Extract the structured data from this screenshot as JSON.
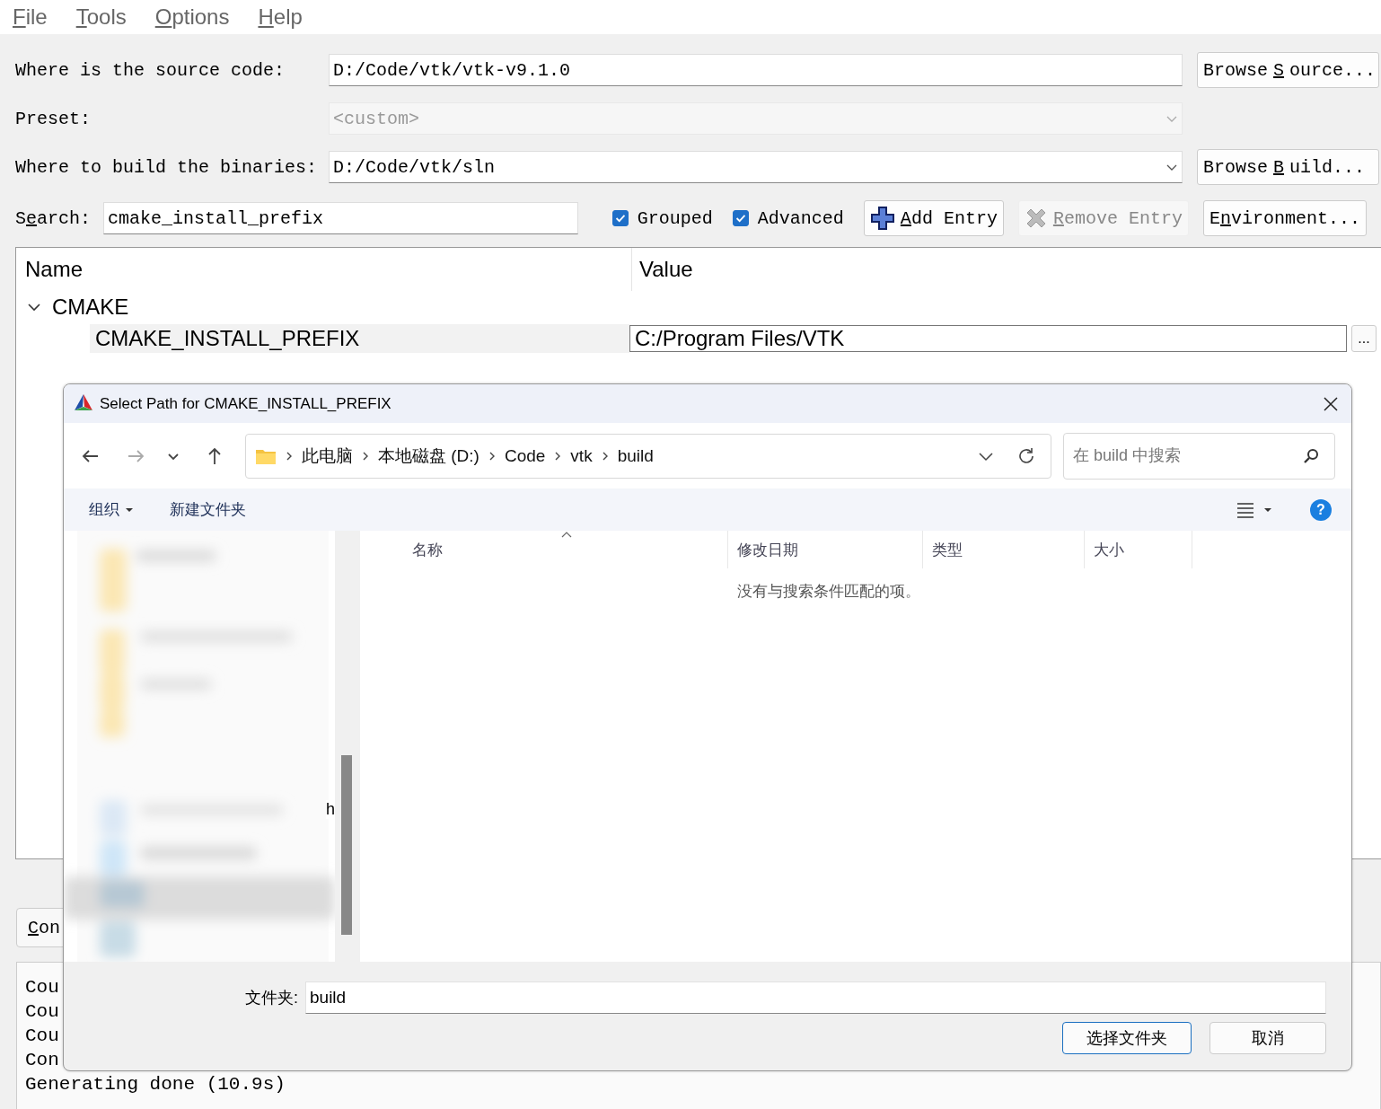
{
  "menu": [
    {
      "label_parts": [
        "F",
        "ile"
      ]
    },
    {
      "label_parts": [
        "T",
        "ools"
      ]
    },
    {
      "label_parts": [
        "O",
        "ptions"
      ]
    },
    {
      "label_parts": [
        "H",
        "elp"
      ]
    }
  ],
  "source": {
    "label": "Where is the source code:",
    "value": "D:/Code/vtk/vtk-v9.1.0",
    "button_parts": [
      "Browse ",
      "S",
      "ource..."
    ]
  },
  "preset": {
    "label": "Preset:",
    "value": "<custom>",
    "disabled": true
  },
  "build": {
    "label": "Where to build the binaries:",
    "value": "D:/Code/vtk/sln",
    "button_parts": [
      "Browse ",
      "B",
      "uild..."
    ]
  },
  "search": {
    "label_parts": [
      "S",
      "e",
      "arch:"
    ],
    "value": "cmake_install_prefix"
  },
  "options": [
    {
      "label": "Grouped",
      "checked": true
    },
    {
      "label": "Advanced",
      "checked": true
    }
  ],
  "actions": [
    {
      "kind": "add",
      "label_parts": [
        "A",
        "dd Entry"
      ],
      "disabled": false
    },
    {
      "kind": "remove",
      "label_parts": [
        "R",
        "emove Entry"
      ],
      "disabled": true
    },
    {
      "kind": "plain",
      "label_parts": [
        "E",
        "n",
        "vironment..."
      ],
      "disabled": false
    }
  ],
  "tree": {
    "columns": [
      "Name",
      "Value"
    ],
    "groups": [
      {
        "label": "CMAKE",
        "expanded": true,
        "children": [
          {
            "name": "CMAKE_INSTALL_PREFIX",
            "value": "C:/Program Files/VTK",
            "selected": true,
            "editor_button": "..."
          }
        ]
      }
    ]
  },
  "configure_button": {
    "label_parts": [
      "C",
      "on"
    ]
  },
  "output": [
    "Cou",
    "Cou",
    "Cou",
    "Con",
    "Generating done (10.9s)"
  ],
  "dialog": {
    "title": "Select Path for CMAKE_INSTALL_PREFIX",
    "nav": [
      {
        "kind": "back",
        "disabled": false
      },
      {
        "kind": "forward",
        "disabled": true
      },
      {
        "kind": "recent",
        "disabled": false
      },
      {
        "kind": "up",
        "disabled": false
      }
    ],
    "breadcrumb": [
      "此电脑",
      "本地磁盘 (D:)",
      "Code",
      "vtk",
      "build"
    ],
    "search_placeholder": "在 build 中搜索",
    "toolbar": {
      "organize": "组织",
      "new_folder": "新建文件夹",
      "help": "?"
    },
    "nav_pane": {
      "kind": "picture",
      "fragment": "h"
    },
    "columns": [
      {
        "label": "名称",
        "sorted": true
      },
      {
        "label": "修改日期",
        "sorted": false
      },
      {
        "label": "类型",
        "sorted": false
      },
      {
        "label": "大小",
        "sorted": false
      }
    ],
    "empty_message": "没有与搜索条件匹配的项。",
    "folder_label": "文件夹:",
    "folder_value": "build",
    "buttons": [
      {
        "label": "选择文件夹",
        "primary": true
      },
      {
        "label": "取消",
        "primary": false
      }
    ]
  }
}
